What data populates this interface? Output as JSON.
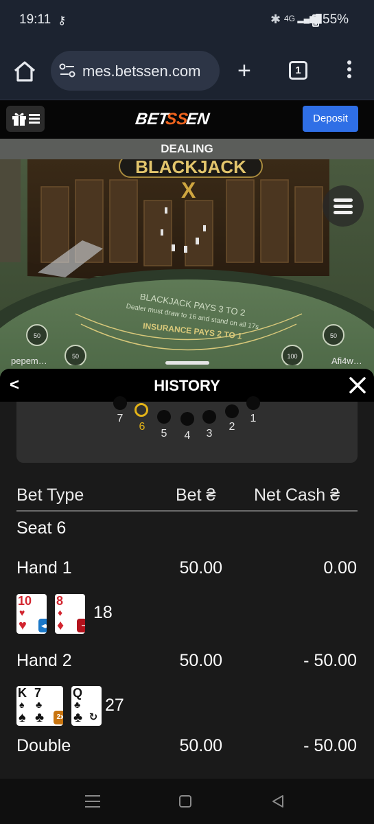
{
  "status_bar": {
    "time": "19:11",
    "battery": "55%",
    "network": "4G"
  },
  "browser": {
    "url": "mes.betssen.com",
    "tab_count": "1"
  },
  "site": {
    "logo": "BETSSEN",
    "deposit_label": "Deposit"
  },
  "game": {
    "status": "DEALING",
    "title": "BLACKJACK",
    "title_mark": "X",
    "felt_line1": "BLACKJACK PAYS 3 TO 2",
    "felt_line2": "Dealer must draw to 16 and stand on all 17s",
    "felt_line3": "INSURANCE PAYS 2 TO 1",
    "player_left": "pepem…",
    "player_right": "Afi4w…",
    "chips": [
      "50",
      "50",
      "100",
      "50"
    ]
  },
  "history": {
    "title": "HISTORY",
    "seats": [
      {
        "num": "7",
        "selected": false
      },
      {
        "num": "6",
        "selected": true
      },
      {
        "num": "5",
        "selected": false
      },
      {
        "num": "4",
        "selected": false
      },
      {
        "num": "3",
        "selected": false
      },
      {
        "num": "2",
        "selected": false
      },
      {
        "num": "1",
        "selected": false
      }
    ],
    "columns": {
      "bet_type": "Bet Type",
      "bet": "Bet ₴",
      "net_cash": "Net Cash ₴"
    },
    "seat_label": "Seat 6",
    "rows": [
      {
        "type": "Hand 1",
        "bet": "50.00",
        "net": "0.00",
        "cards": [
          {
            "rank": "10",
            "suit": "♥",
            "color": "red",
            "badge": "split",
            "badge_color": "#1b78c8",
            "badge_glyph": "◂▸"
          },
          {
            "rank": "8",
            "suit": "♦",
            "color": "red",
            "badge": "stand",
            "badge_color": "#b3121c",
            "badge_glyph": "−"
          }
        ],
        "total": "18"
      },
      {
        "type": "Hand 2",
        "bet": "50.00",
        "net": "- 50.00",
        "cards": [
          {
            "rank": "K",
            "suit": "♠",
            "color": "black",
            "badge": "",
            "badge_color": "",
            "badge_glyph": ""
          },
          {
            "rank": "7",
            "suit": "♣",
            "color": "black",
            "badge": "double",
            "badge_color": "#c8740f",
            "badge_glyph": "2x"
          },
          {
            "rank": "Q",
            "suit": "♣",
            "color": "black",
            "badge": "hit",
            "badge_color": "#ffffff",
            "badge_glyph": "↻"
          }
        ],
        "total": "27"
      },
      {
        "type": "Double",
        "bet": "50.00",
        "net": "- 50.00",
        "cards": [],
        "total": ""
      }
    ]
  }
}
